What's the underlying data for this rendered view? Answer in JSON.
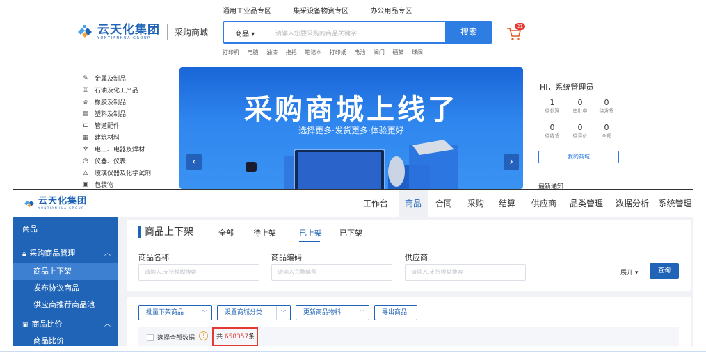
{
  "shop": {
    "toplinks": [
      "通用工业品专区",
      "集采设备物资专区",
      "办公用品专区"
    ],
    "logo_cn": "云天化集团",
    "logo_en": "YUNTIANHUA GROUP",
    "logo_sub": "采购商城",
    "search_category": "商品 ▾",
    "search_placeholder": "请输入您要采购的商品关键字",
    "search_button": "搜索",
    "cart_count": "21",
    "hotwords": [
      "打印机",
      "电脑",
      "油漆",
      "拖把",
      "笔记本",
      "打印纸",
      "电池",
      "阀门",
      "硒鼓",
      "球阀"
    ],
    "categories": [
      {
        "icon": "wrench-icon",
        "glyph": "✎",
        "label": "金属及制品"
      },
      {
        "icon": "oil-icon",
        "glyph": "♖",
        "label": "石油及化工产品"
      },
      {
        "icon": "rubber-icon",
        "glyph": "⌀",
        "label": "橡胶及制品"
      },
      {
        "icon": "plastic-icon",
        "glyph": "▤",
        "label": "塑料及制品"
      },
      {
        "icon": "pipe-icon",
        "glyph": "⊏",
        "label": "管道配件"
      },
      {
        "icon": "building-icon",
        "glyph": "▦",
        "label": "建筑材料"
      },
      {
        "icon": "electric-icon",
        "glyph": "♆",
        "label": "电工、电器及焊材"
      },
      {
        "icon": "gauge-icon",
        "glyph": "◷",
        "label": "仪器、仪表"
      },
      {
        "icon": "flask-icon",
        "glyph": "△",
        "label": "玻璃仪器及化学试剂"
      },
      {
        "icon": "package-icon",
        "glyph": "▣",
        "label": "包装物"
      }
    ],
    "banner_title": "采购商城上线了",
    "banner_subtitle": "选择更多·发货更多·体验更好",
    "user_greeting": "Hi，系统管理员",
    "user_stats": [
      {
        "value": "1",
        "label": "待处理"
      },
      {
        "value": "0",
        "label": "审批中"
      },
      {
        "value": "0",
        "label": "待发货"
      },
      {
        "value": "0",
        "label": "待收货"
      },
      {
        "value": "0",
        "label": "待评价"
      },
      {
        "value": "0",
        "label": "全部"
      }
    ],
    "my_mall": "我的商城",
    "notice": "最新通知"
  },
  "admin": {
    "logo_cn": "云天化集团",
    "logo_en": "YUNTIANHUA GROUP",
    "nav": [
      "工作台",
      "商品",
      "合同",
      "采购",
      "结算",
      "供应商",
      "品类管理",
      "数据分析",
      "系统管理"
    ],
    "nav_active": "商品",
    "sidebar": {
      "title": "商品",
      "group": "采购商品管理",
      "items": [
        "商品上下架",
        "发布协议商品",
        "供应商推荐商品池"
      ],
      "group2": "商品比价",
      "item2": "商品比价"
    },
    "page_title": "商品上下架",
    "tabs": [
      "全部",
      "待上架",
      "已上架",
      "已下架"
    ],
    "active_tab": "已上架",
    "filters": [
      {
        "label": "商品名称",
        "placeholder": "请输入,支持模糊搜索"
      },
      {
        "label": "商品编码",
        "placeholder": "请输入完整编号"
      },
      {
        "label": "供应商",
        "placeholder": "请输入,支持模糊搜索"
      }
    ],
    "expand": "展开 ▾",
    "query": "查询",
    "ops": [
      "批量下架商品",
      "设置商城分类",
      "更新商品物料",
      "导出商品"
    ],
    "select_all": "选择全部数据",
    "total_prefix": "共 ",
    "total_count": "658357",
    "total_suffix": "条"
  },
  "colors": {
    "brand": "#1f64b6",
    "accent": "#2e7de3",
    "highlight": "#e53935"
  }
}
